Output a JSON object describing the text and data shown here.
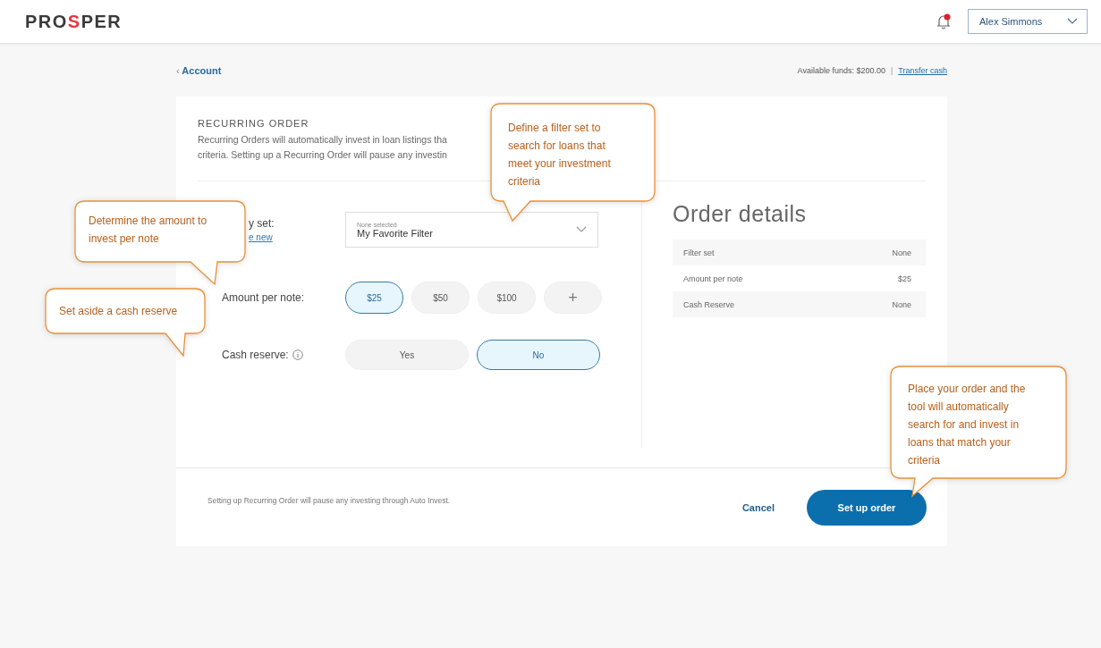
{
  "header": {
    "logo": "PROSPER",
    "notification": {
      "unread": true
    },
    "user_menu": {
      "label": "Alex Simmons"
    }
  },
  "back_link": {
    "icon": "‹",
    "label": "Account"
  },
  "funds": {
    "label": "Available funds: $200.00",
    "separator": "|",
    "link": "Transfer cash"
  },
  "section": {
    "title": "RECURRING ORDER",
    "description_lines": [
      "Recurring Orders will automatically invest in loan listings tha",
      "criteria. Setting up a Recurring Order will pause any investin"
    ]
  },
  "form": {
    "filter": {
      "label": "y set:",
      "link": "e new",
      "dropdown": {
        "caption": "None selected",
        "value": "My Favorite Filter"
      }
    },
    "amount": {
      "label": "Amount per note:",
      "options": [
        {
          "label": "$25",
          "selected": true
        },
        {
          "label": "$50",
          "selected": false
        },
        {
          "label": "$100",
          "selected": false
        },
        {
          "label": "+",
          "selected": false
        }
      ]
    },
    "cash_reserve": {
      "label": "Cash reserve:",
      "options": [
        {
          "label": "Yes",
          "selected": false
        },
        {
          "label": "No",
          "selected": true
        }
      ]
    }
  },
  "order_details": {
    "title": "Order details",
    "rows": [
      {
        "label": "Filter set",
        "value": "None"
      },
      {
        "label": "Amount per note",
        "value": "$25"
      },
      {
        "label": "Cash Reserve",
        "value": "None"
      }
    ]
  },
  "footer": {
    "note": "Setting up Recurring Order will pause any investing through Auto Invest.",
    "buttons": [
      {
        "label": "Cancel",
        "kind": "link"
      },
      {
        "label": "Set up order",
        "kind": "primary"
      }
    ]
  },
  "callouts": [
    {
      "text": "Define a filter set to search for loans that meet your investment criteria"
    },
    {
      "text": "Determine the amount to invest per note"
    },
    {
      "text": "Set aside a cash reserve"
    },
    {
      "text": "Place your order and the tool will automatically search for and invest in loans that match your criteria"
    }
  ]
}
